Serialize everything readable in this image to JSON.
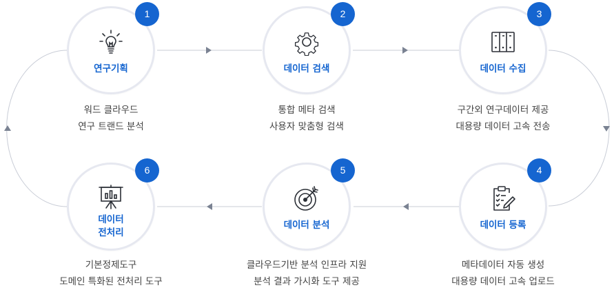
{
  "steps": [
    {
      "number": "1",
      "title": "연구기획",
      "icon": "lightbulb-icon",
      "desc": [
        "워드 클라우드",
        "연구 트랜드 분석"
      ]
    },
    {
      "number": "2",
      "title": "데이터 검색",
      "icon": "gear-icon",
      "desc": [
        "통합 메타 검색",
        "사용자 맞춤형 검색"
      ]
    },
    {
      "number": "3",
      "title": "데이터 수집",
      "icon": "server-rack-icon",
      "desc": [
        "구간외 연구데이터 제공",
        "대용량 데이터 고속 전송"
      ]
    },
    {
      "number": "4",
      "title": "데이터 등록",
      "icon": "clipboard-edit-icon",
      "desc": [
        "메타데이터 자동 생성",
        "대용량 데이터 고속 업로드"
      ]
    },
    {
      "number": "5",
      "title": "데이터 분석",
      "icon": "target-icon",
      "desc": [
        "클라우드기반 분석 인프라 지원",
        "분석 결과 가시화 도구 제공"
      ]
    },
    {
      "number": "6",
      "title_lines": [
        "데이터",
        "전처리"
      ],
      "icon": "presentation-chart-icon",
      "desc": [
        "기본정제도구",
        "도메인 특화된 전처리 도구"
      ]
    }
  ],
  "colors": {
    "accent": "#1565d0",
    "circle_border": "#e6e8f0",
    "connector": "#c8ccd6",
    "arrow": "#7a8292",
    "text": "#444444"
  }
}
